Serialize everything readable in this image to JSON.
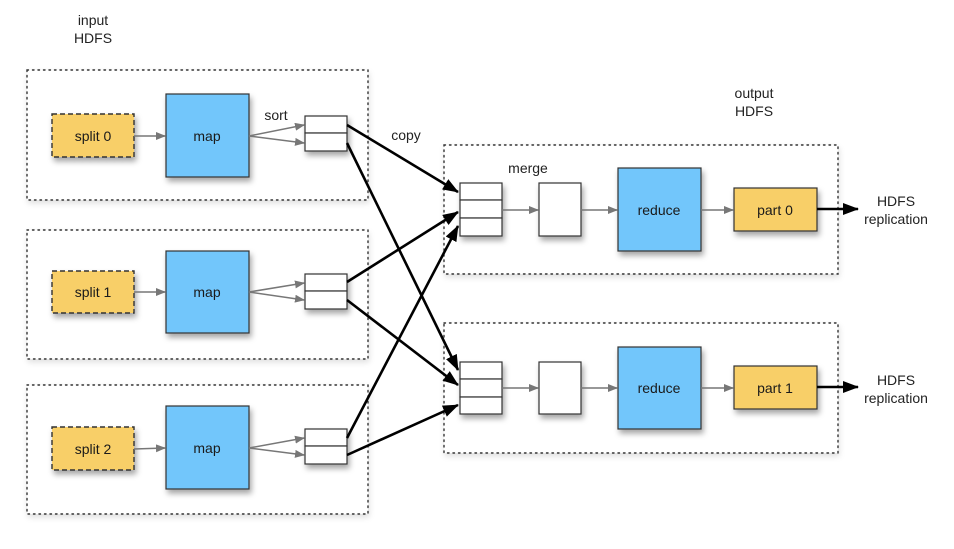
{
  "labels": {
    "input_title": [
      "input",
      "HDFS"
    ],
    "output_title": [
      "output",
      "HDFS"
    ],
    "sort": "sort",
    "copy": "copy",
    "merge": "merge",
    "replication": [
      "HDFS",
      "replication"
    ]
  },
  "map_side": [
    {
      "split": "split 0",
      "task": "map"
    },
    {
      "split": "split 1",
      "task": "map"
    },
    {
      "split": "split 2",
      "task": "map"
    }
  ],
  "reduce_side": [
    {
      "task": "reduce",
      "part": "part 0"
    },
    {
      "task": "reduce",
      "part": "part 1"
    }
  ],
  "colors": {
    "split_fill": "#f8cf68",
    "part_fill": "#f8cf68",
    "task_fill": "#72c6fb",
    "buffer_fill": "#ffffff",
    "thin_arrow": "#777777",
    "thick_arrow": "#000000"
  }
}
